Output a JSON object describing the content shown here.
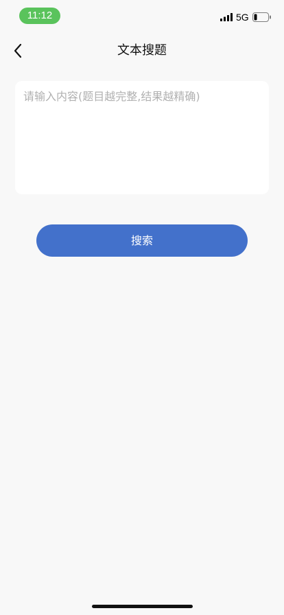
{
  "status_bar": {
    "time": "11:12",
    "network": "5G",
    "time_pill_color": "#5ac35c",
    "icons": {
      "signal": "signal-bars-icon",
      "battery": "battery-icon"
    }
  },
  "nav": {
    "title": "文本搜题",
    "back_icon": "chevron-left-icon"
  },
  "input": {
    "value": "",
    "placeholder": "请输入内容(题目越完整,结果越精确)"
  },
  "search_button": {
    "label": "搜索",
    "color": "#4371cb"
  },
  "colors": {
    "background": "#f8f8f8",
    "card": "#ffffff"
  }
}
